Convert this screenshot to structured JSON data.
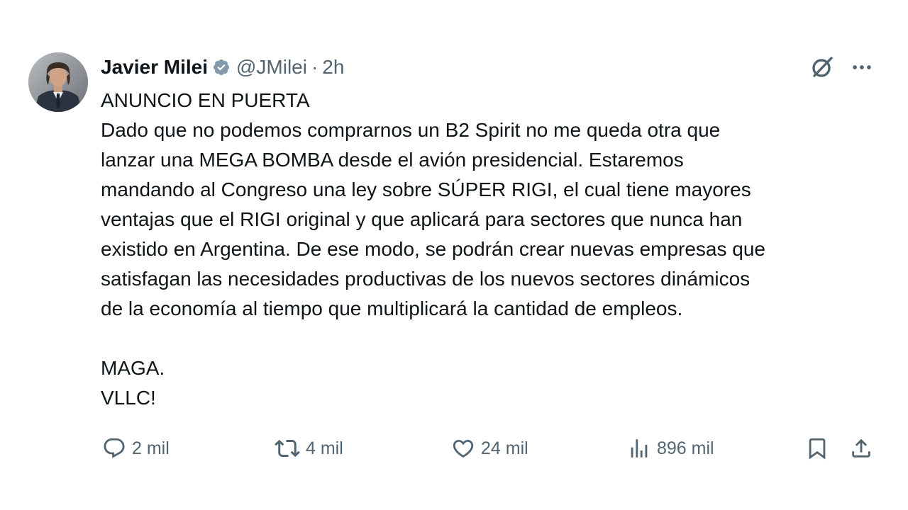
{
  "tweet": {
    "author_name": "Javier Milei",
    "handle": "@JMilei",
    "separator": "·",
    "time": "2h",
    "icons": {
      "verified": "verified-badge-icon",
      "grok": "grok-icon",
      "more": "more-icon"
    },
    "body": {
      "line1": "ANUNCIO EN PUERTA",
      "line2": "Dado que no podemos comprarnos un B2 Spirit no me queda otra que",
      "line3": "lanzar una MEGA BOMBA desde el avión presidencial. Estaremos",
      "line4": "mandando al Congreso una ley sobre SÚPER RIGI, el cual tiene mayores",
      "line5": "ventajas que el RIGI original y que aplicará para sectores que nunca han",
      "line6": "existido en Argentina. De ese modo, se podrán crear nuevas empresas que",
      "line7": "satisfagan las necesidades productivas de los nuevos sectores dinámicos",
      "line8": "de la economía al tiempo que multiplicará la cantidad de empleos.",
      "line9": "MAGA.",
      "line10": "VLLC!"
    },
    "actions": {
      "reply_count": "2 mil",
      "repost_count": "4 mil",
      "like_count": "24 mil",
      "views_count": "896 mil"
    },
    "colors": {
      "text": "#0f1419",
      "secondary": "#536471",
      "verified": "#829aab"
    }
  }
}
